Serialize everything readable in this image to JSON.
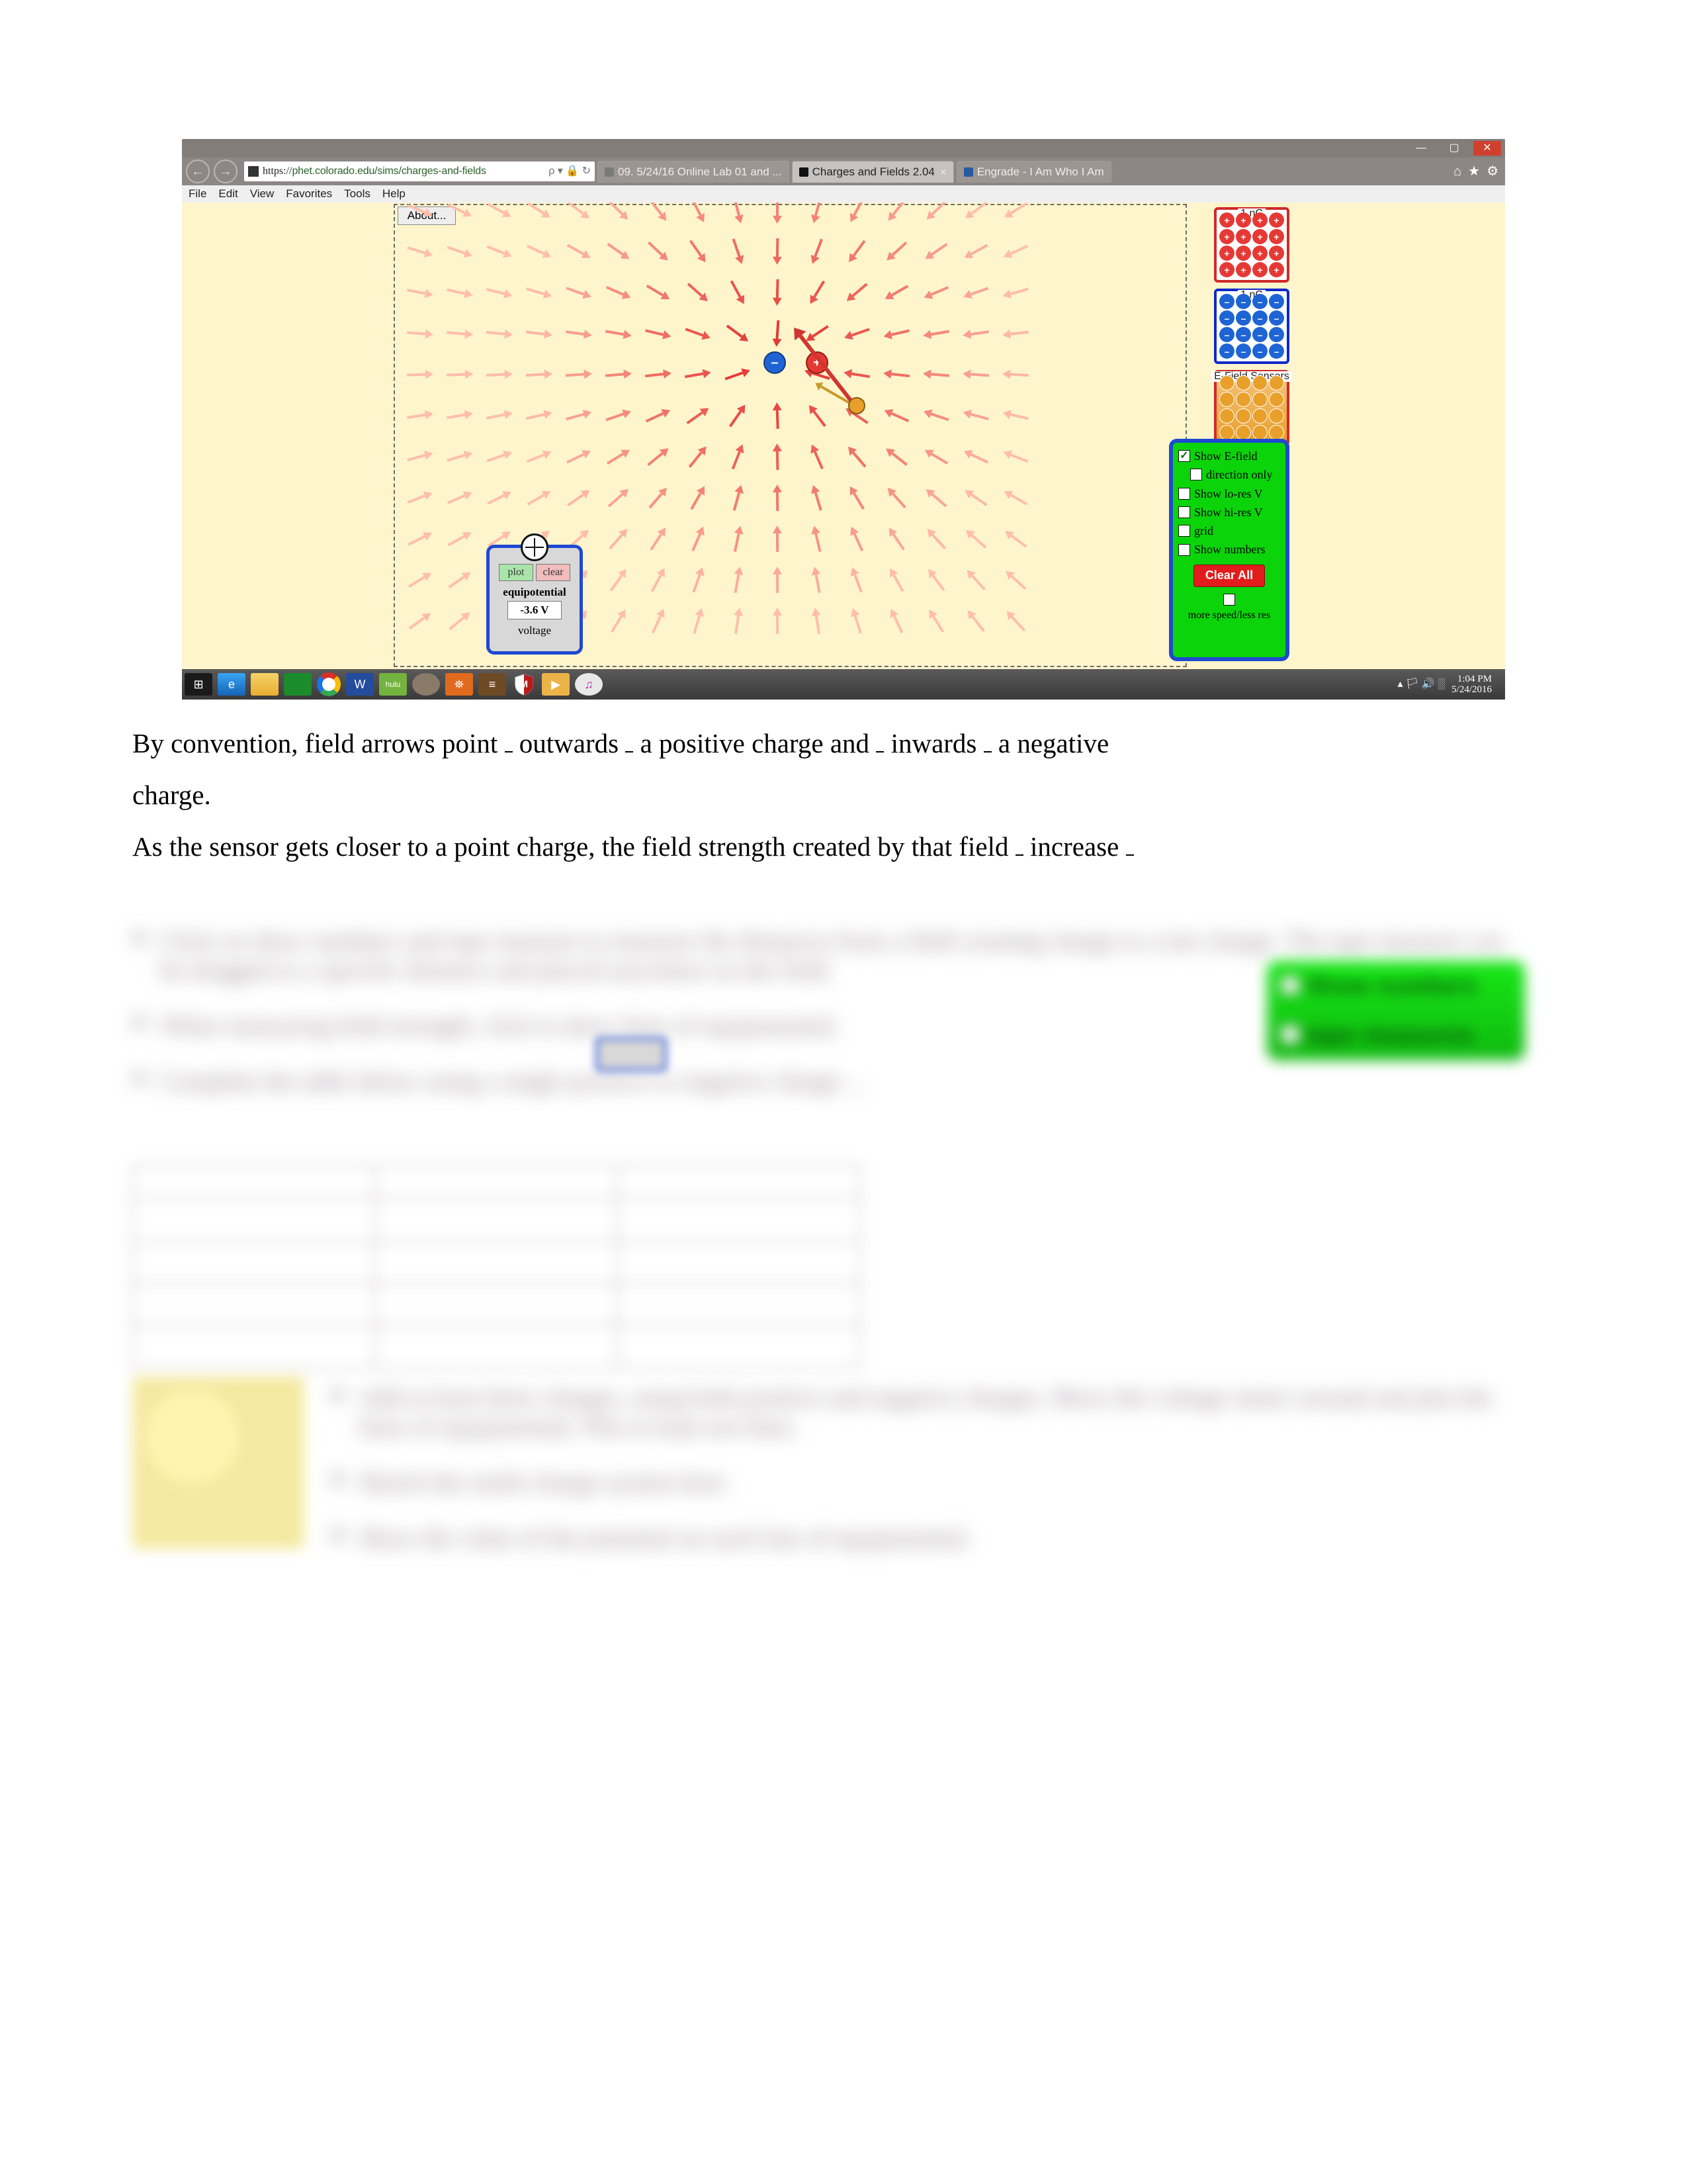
{
  "browser": {
    "window_buttons": {
      "minimize": "—",
      "maximize": "▢",
      "close": "✕"
    },
    "nav": {
      "back": "←",
      "forward": "→"
    },
    "address": {
      "protocol_prefix": "https://",
      "url": "phet.colorado.edu/sims/charges-and-fields",
      "suffix": " ρ ▾ 🔒 ↻",
      "search_icon": "🔍"
    },
    "tabs": [
      {
        "label": "09. 5/24/16 Online Lab 01 and ..."
      },
      {
        "label": "Charges and Fields 2.04",
        "close": "×",
        "active": true
      },
      {
        "label": "Engrade - I Am Who I Am"
      }
    ],
    "system_icons": [
      "⌂",
      "★",
      "⚙"
    ],
    "menus": [
      "File",
      "Edit",
      "View",
      "Favorites",
      "Tools",
      "Help"
    ]
  },
  "simulation": {
    "about_button": "About...",
    "charge_source_boxes": {
      "positive": {
        "label": "1 nC",
        "symbol": "+"
      },
      "negative": {
        "label": "1 nC",
        "symbol": "–"
      },
      "sensors": {
        "label": "E-Field Sensors"
      }
    },
    "options_panel": {
      "rows": [
        {
          "label": "Show E-field",
          "checked": true
        },
        {
          "label": "direction only",
          "checked": false,
          "indent": true
        },
        {
          "label": "Show lo-res V",
          "checked": false
        },
        {
          "label": "Show hi-res V",
          "checked": false
        },
        {
          "label": "grid",
          "checked": false
        },
        {
          "label": "Show numbers",
          "checked": false
        }
      ],
      "clear_button": "Clear All",
      "more_speed": {
        "label": "more speed/less res",
        "checked": false
      }
    },
    "voltage_tool": {
      "plot": "plot",
      "clear": "clear",
      "equip_label": "equipotential",
      "value": "-3.6 V",
      "voltage_label": "voltage"
    },
    "placed_charges": {
      "positive_symbol": "+",
      "negative_symbol": "–"
    }
  },
  "taskbar": {
    "icons": {
      "start": "⊞",
      "ie": "e",
      "word": "W",
      "hulu": "hulu",
      "launch": "⛯",
      "tex": "≡",
      "play": "▶",
      "itunes": "♫"
    },
    "mcafee_svg_name": "mcafee-shield-icon",
    "systray_glyphs": "▴ 🏳 🔊 ░",
    "clock": {
      "time": "1:04 PM",
      "date": "5/24/2016"
    }
  },
  "document_text": {
    "line1_a": "By convention, field arrows point ",
    "blank_len1": "                ",
    "ans1": "outwards",
    "blank_len2": "            ",
    "line1_b": " a positive charge and ",
    "ans2": "inwards",
    "line1_c": " a negative",
    "line2": "charge.",
    "line3_a": "As the sensor gets closer to a point charge, the field strength created by that field ",
    "ans3": "increase",
    "blank_len3": "            ",
    "blank_len4": "                              "
  },
  "blurred_preview": {
    "p1": "Click on show numbers and tape measure to measure the distances from a field creating charge to a test charge.  The tape measure can be dragged to a specific distance and placed anywhere on the field.",
    "p2": "When measuring field strength, click            to draw lines of equipotential.",
    "p3": "Complete the table below using a single positive or negative charge ...",
    "green1": "Show numbers",
    "green2": "tape measures",
    "bullets2": [
      "Add at least three charges, using both positive and negative charges.  Move the voltage meter around and plot the lines of equipotential.  Plot at least ten lines.",
      "Sketch the multi-charge system here.",
      "Show the value of the potential on each line of equipotential."
    ]
  }
}
